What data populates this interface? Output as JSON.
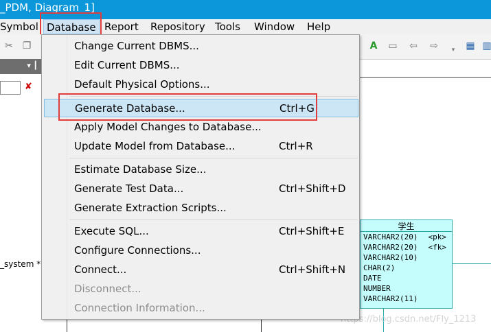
{
  "window": {
    "title": "_PDM, Diagram_1]"
  },
  "menubar": {
    "items": [
      "Symbol",
      "Database",
      "Report",
      "Repository",
      "Tools",
      "Window",
      "Help"
    ],
    "active": "Database"
  },
  "left_panel": {
    "label": "_system *"
  },
  "database_menu": {
    "items": [
      {
        "label": "Change Current DBMS...",
        "shortcut": "",
        "enabled": true
      },
      {
        "label": "Edit Current DBMS...",
        "shortcut": "",
        "enabled": true
      },
      {
        "label": "Default Physical Options...",
        "shortcut": "",
        "enabled": true
      },
      {
        "label": "Generate Database...",
        "shortcut": "Ctrl+G",
        "enabled": true,
        "highlighted": true
      },
      {
        "label": "Apply Model Changes to Database...",
        "shortcut": "",
        "enabled": true
      },
      {
        "label": "Update Model from Database...",
        "shortcut": "Ctrl+R",
        "enabled": true
      },
      {
        "label": "Estimate Database Size...",
        "shortcut": "",
        "enabled": true
      },
      {
        "label": "Generate Test Data...",
        "shortcut": "Ctrl+Shift+D",
        "enabled": true
      },
      {
        "label": "Generate Extraction Scripts...",
        "shortcut": "",
        "enabled": true
      },
      {
        "label": "Execute SQL...",
        "shortcut": "Ctrl+Shift+E",
        "enabled": true
      },
      {
        "label": "Configure Connections...",
        "shortcut": "",
        "enabled": true
      },
      {
        "label": "Connect...",
        "shortcut": "Ctrl+Shift+N",
        "enabled": true
      },
      {
        "label": "Disconnect...",
        "shortcut": "",
        "enabled": false
      },
      {
        "label": "Connection Information...",
        "shortcut": "",
        "enabled": false
      }
    ]
  },
  "diagram_table": {
    "name": "学生",
    "columns": [
      {
        "type": "VARCHAR2(20)",
        "key": "<pk>"
      },
      {
        "type": "VARCHAR2(20)",
        "key": "<fk>"
      },
      {
        "type": "VARCHAR2(10)",
        "key": ""
      },
      {
        "type": "CHAR(2)",
        "key": ""
      },
      {
        "type": "DATE",
        "key": ""
      },
      {
        "type": "NUMBER",
        "key": ""
      },
      {
        "type": "VARCHAR2(11)",
        "key": ""
      }
    ]
  },
  "watermark": "https://blog.csdn.net/Fly_1213",
  "colors": {
    "titlebar": "#0b97d9",
    "highlight": "#cce6f6",
    "annotation": "#e03c3c",
    "table_fill": "#c5fcfc"
  }
}
